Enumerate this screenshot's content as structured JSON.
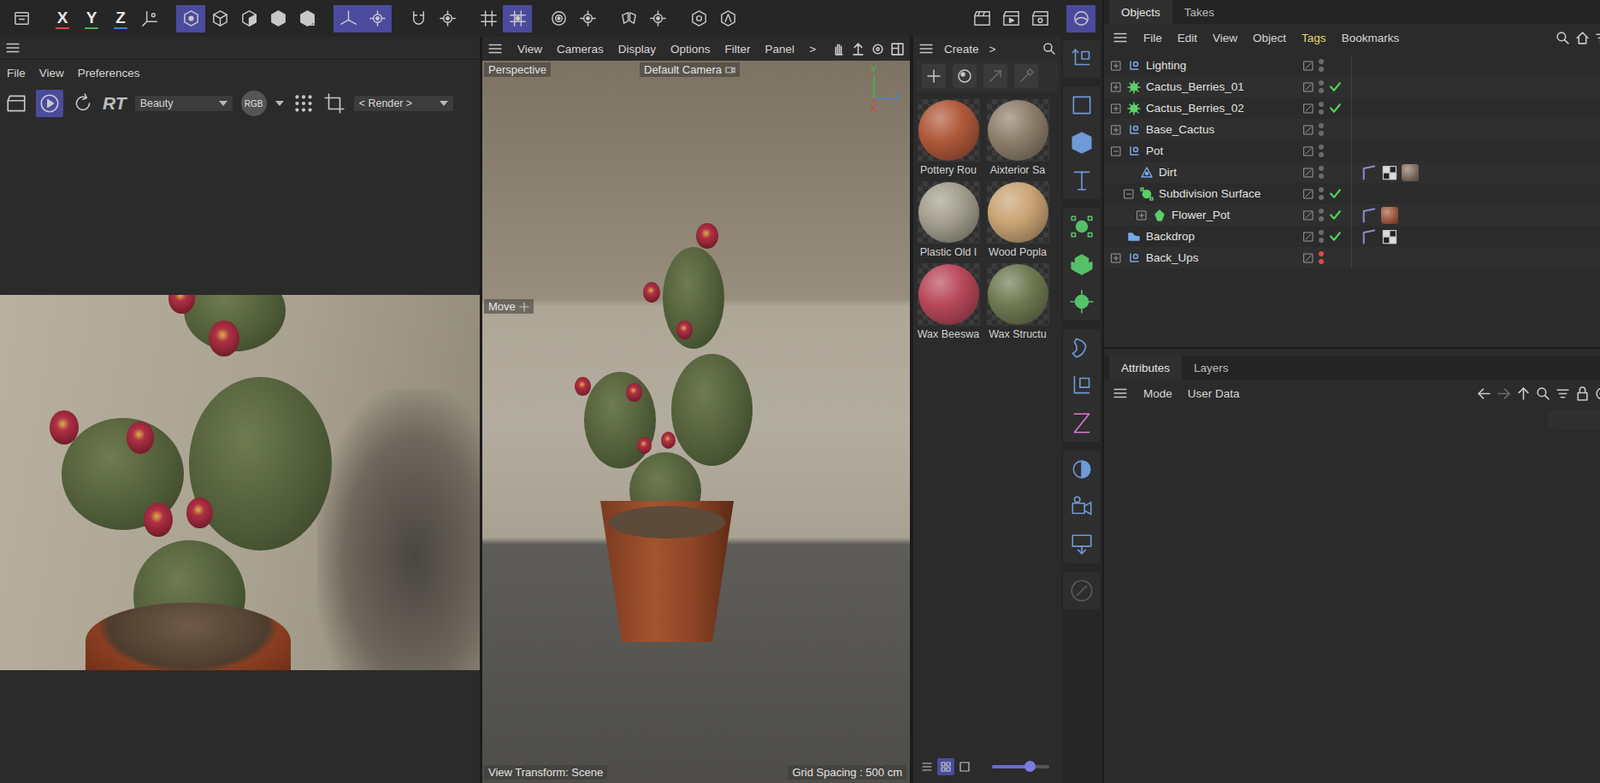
{
  "toolbar": {
    "groups": [
      {
        "items": [
          {
            "kind": "archive",
            "selected": false
          }
        ]
      },
      {
        "items": [
          {
            "kind": "letter",
            "label": "X",
            "color": "#e0453f",
            "selected": false
          },
          {
            "kind": "letter",
            "label": "Y",
            "color": "#47b04b",
            "selected": false
          },
          {
            "kind": "letter",
            "label": "Z",
            "color": "#3f7fd8",
            "selected": false
          },
          {
            "kind": "coords",
            "selected": false
          }
        ]
      },
      {
        "items": [
          {
            "kind": "model",
            "selected": true
          },
          {
            "kind": "points",
            "selected": false
          },
          {
            "kind": "edges",
            "selected": false
          },
          {
            "kind": "polys",
            "selected": false
          },
          {
            "kind": "uv",
            "selected": false
          }
        ]
      },
      {
        "items": [
          {
            "kind": "axis",
            "selected": true
          },
          {
            "kind": "gear",
            "selected": true
          }
        ]
      },
      {
        "items": [
          {
            "kind": "magnet",
            "selected": false
          },
          {
            "kind": "gear",
            "selected": false
          }
        ]
      },
      {
        "items": [
          {
            "kind": "grid",
            "selected": false
          },
          {
            "kind": "snapgrid",
            "selected": true
          }
        ]
      },
      {
        "items": [
          {
            "kind": "target",
            "selected": false
          },
          {
            "kind": "gear",
            "selected": false
          }
        ]
      },
      {
        "items": [
          {
            "kind": "symmetry",
            "selected": false
          },
          {
            "kind": "gear",
            "selected": false
          }
        ]
      },
      {
        "items": [
          {
            "kind": "solo",
            "selected": false
          },
          {
            "kind": "autokey",
            "selected": false
          }
        ]
      }
    ],
    "right_groups": [
      {
        "items": [
          {
            "kind": "clapper",
            "selected": false
          },
          {
            "kind": "render",
            "selected": false
          },
          {
            "kind": "rendersettings",
            "selected": false
          }
        ]
      },
      {
        "items": [
          {
            "kind": "sphere",
            "selected": true
          }
        ]
      }
    ]
  },
  "render_view": {
    "menu": [
      "File",
      "View",
      "Preferences"
    ],
    "play_selected": true,
    "rt": "RT",
    "pass": "Beauty",
    "channel": "RGB",
    "mode": "< Render >"
  },
  "viewport": {
    "menu": [
      "View",
      "Cameras",
      "Display",
      "Options",
      "Filter",
      "Panel",
      ">"
    ],
    "label": "Perspective",
    "camera": "Default Camera",
    "tool": "Move",
    "axes": {
      "y": "Y",
      "z": "Z",
      "x": "X"
    },
    "view_transform": "View Transform: Scene",
    "grid_spacing": "Grid Spacing : 500 cm"
  },
  "materials": {
    "menu": [
      "Create",
      ">"
    ],
    "items": [
      {
        "name": "Pottery Rou",
        "color": "#b0593a"
      },
      {
        "name": "Aixterior Sa",
        "color": "#8e7f6c"
      },
      {
        "name": "Plastic Old I",
        "color": "#a39f8e"
      },
      {
        "name": "Wood Popla",
        "color": "#c9a474"
      },
      {
        "name": "Wax Beeswa",
        "color": "#b8485a"
      },
      {
        "name": "Wax Structu",
        "color": "#6f7a52"
      }
    ],
    "view_modes": [
      {
        "kind": "list",
        "selected": false
      },
      {
        "kind": "grid",
        "selected": true
      },
      {
        "kind": "single",
        "selected": false
      }
    ],
    "zoom": {
      "level": 0.65
    }
  },
  "strip": {
    "groups": [
      [
        "move"
      ],
      [
        "square",
        "cube",
        "text"
      ],
      [
        "generator",
        "cloner",
        "effector"
      ],
      [
        "deformer",
        "field",
        "spline-deform"
      ],
      [
        "light",
        "camera",
        "floor"
      ],
      [
        "pencil"
      ]
    ]
  },
  "objects": {
    "tabs": [
      {
        "label": "Objects",
        "selected": true
      },
      {
        "label": "Takes",
        "selected": false
      }
    ],
    "menu": [
      {
        "label": "File",
        "highlighted": false
      },
      {
        "label": "Edit",
        "highlighted": false
      },
      {
        "label": "View",
        "highlighted": false
      },
      {
        "label": "Object",
        "highlighted": false
      },
      {
        "label": "Tags",
        "highlighted": true
      },
      {
        "label": "Bookmarks",
        "highlighted": false
      }
    ],
    "rows": [
      {
        "name": "Lighting",
        "depth": 0,
        "expandable": true,
        "expanded": false,
        "kind": "null",
        "checked": false,
        "dot_color": "#6b6b6b",
        "tags": []
      },
      {
        "name": "Cactus_Berries_01",
        "depth": 0,
        "expandable": true,
        "expanded": false,
        "kind": "cloner",
        "checked": true,
        "dot_color": "#6b6b6b",
        "tags": []
      },
      {
        "name": "Cactus_Berries_02",
        "depth": 0,
        "expandable": true,
        "expanded": false,
        "kind": "cloner",
        "checked": true,
        "dot_color": "#6b6b6b",
        "tags": []
      },
      {
        "name": "Base_Cactus",
        "depth": 0,
        "expandable": true,
        "expanded": false,
        "kind": "null",
        "checked": false,
        "dot_color": "#6b6b6b",
        "tags": []
      },
      {
        "name": "Pot",
        "depth": 0,
        "expandable": true,
        "expanded": true,
        "kind": "null",
        "checked": false,
        "dot_color": "#6b6b6b",
        "tags": []
      },
      {
        "name": "Dirt",
        "depth": 1,
        "expandable": false,
        "expanded": false,
        "kind": "emitter",
        "checked": false,
        "dot_color": "#6b6b6b",
        "tags": [
          {
            "kind": "phong",
            "color": "#8b8bd8"
          },
          {
            "kind": "checker",
            "color": "#dddddd"
          },
          {
            "kind": "material",
            "color": "#8a7560"
          }
        ]
      },
      {
        "name": "Subdivision Surface",
        "depth": 1,
        "expandable": true,
        "expanded": true,
        "kind": "subdiv",
        "checked": true,
        "dot_color": "#6b6b6b",
        "tags": []
      },
      {
        "name": "Flower_Pot",
        "depth": 2,
        "expandable": true,
        "expanded": false,
        "kind": "poly",
        "checked": true,
        "dot_color": "#6b6b6b",
        "tags": [
          {
            "kind": "phong",
            "color": "#8b8bd8"
          },
          {
            "kind": "material",
            "color": "#b0593a"
          }
        ]
      },
      {
        "name": "Backdrop",
        "depth": 0,
        "expandable": false,
        "expanded": false,
        "kind": "backdrop",
        "checked": true,
        "dot_color": "#6b6b6b",
        "tags": [
          {
            "kind": "phong",
            "color": "#8b8bd8"
          },
          {
            "kind": "checker",
            "color": "#dddddd"
          }
        ]
      },
      {
        "name": "Back_Ups",
        "depth": 0,
        "expandable": true,
        "expanded": false,
        "kind": "null",
        "checked": false,
        "dot_color": "#e04848",
        "tags": []
      }
    ]
  },
  "attributes": {
    "tabs": [
      {
        "label": "Attributes",
        "selected": true
      },
      {
        "label": "Layers",
        "selected": false
      }
    ],
    "menu": [
      "Mode",
      "User Data"
    ]
  }
}
